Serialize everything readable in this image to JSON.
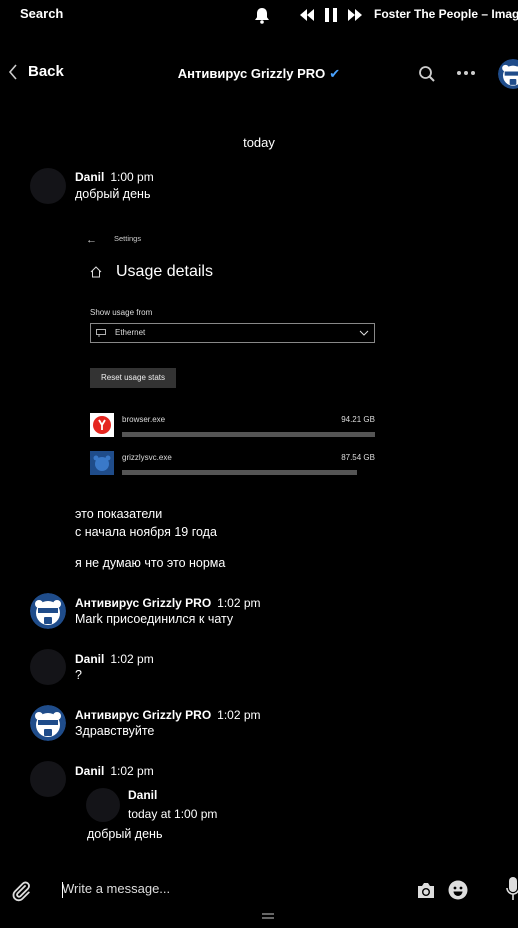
{
  "status_bar": {
    "search_label": "Search",
    "now_playing": "Foster The People – Imag",
    "icons": [
      "bell-icon",
      "previous-icon",
      "pause-icon",
      "next-icon"
    ]
  },
  "header": {
    "back_label": "Back",
    "title": "Антивирус Grizzly PRO",
    "verified_icon": "check-icon",
    "accent_color": "#4aa3ff"
  },
  "date_separator": "today",
  "messages": [
    {
      "name": "Danil",
      "time": "1:00 pm",
      "lines": [
        "добрый день"
      ]
    },
    {
      "lines": [
        "это показатели",
        "с начала ноября 19 года"
      ]
    },
    {
      "lines": [
        "я не думаю что это норма"
      ]
    },
    {
      "name": "Антивирус Grizzly PRO",
      "time": "1:02 pm",
      "lines": [
        "Mark присоединился к чату"
      ]
    },
    {
      "name": "Danil",
      "time": "1:02 pm",
      "lines": [
        "?"
      ]
    },
    {
      "name": "Антивирус Grizzly PRO",
      "time": "1:02 pm",
      "lines": [
        "Здравствуйте"
      ]
    },
    {
      "name": "Danil",
      "time": "1:02 pm",
      "lines": []
    }
  ],
  "attachment": {
    "settings_label": "Settings",
    "title": "Usage details",
    "show_usage_from": "Show usage from",
    "network": "Ethernet",
    "reset_button": "Reset usage stats",
    "apps": [
      {
        "name": "browser.exe",
        "size": "94.21 GB",
        "usage_fraction": 1.0
      },
      {
        "name": "grizzlysvc.exe",
        "size": "87.54 GB",
        "usage_fraction": 0.93
      }
    ]
  },
  "quote": {
    "name": "Danil",
    "meta": "today at 1:00 pm",
    "text": "добрый день"
  },
  "composer": {
    "placeholder": "Write a message..."
  }
}
